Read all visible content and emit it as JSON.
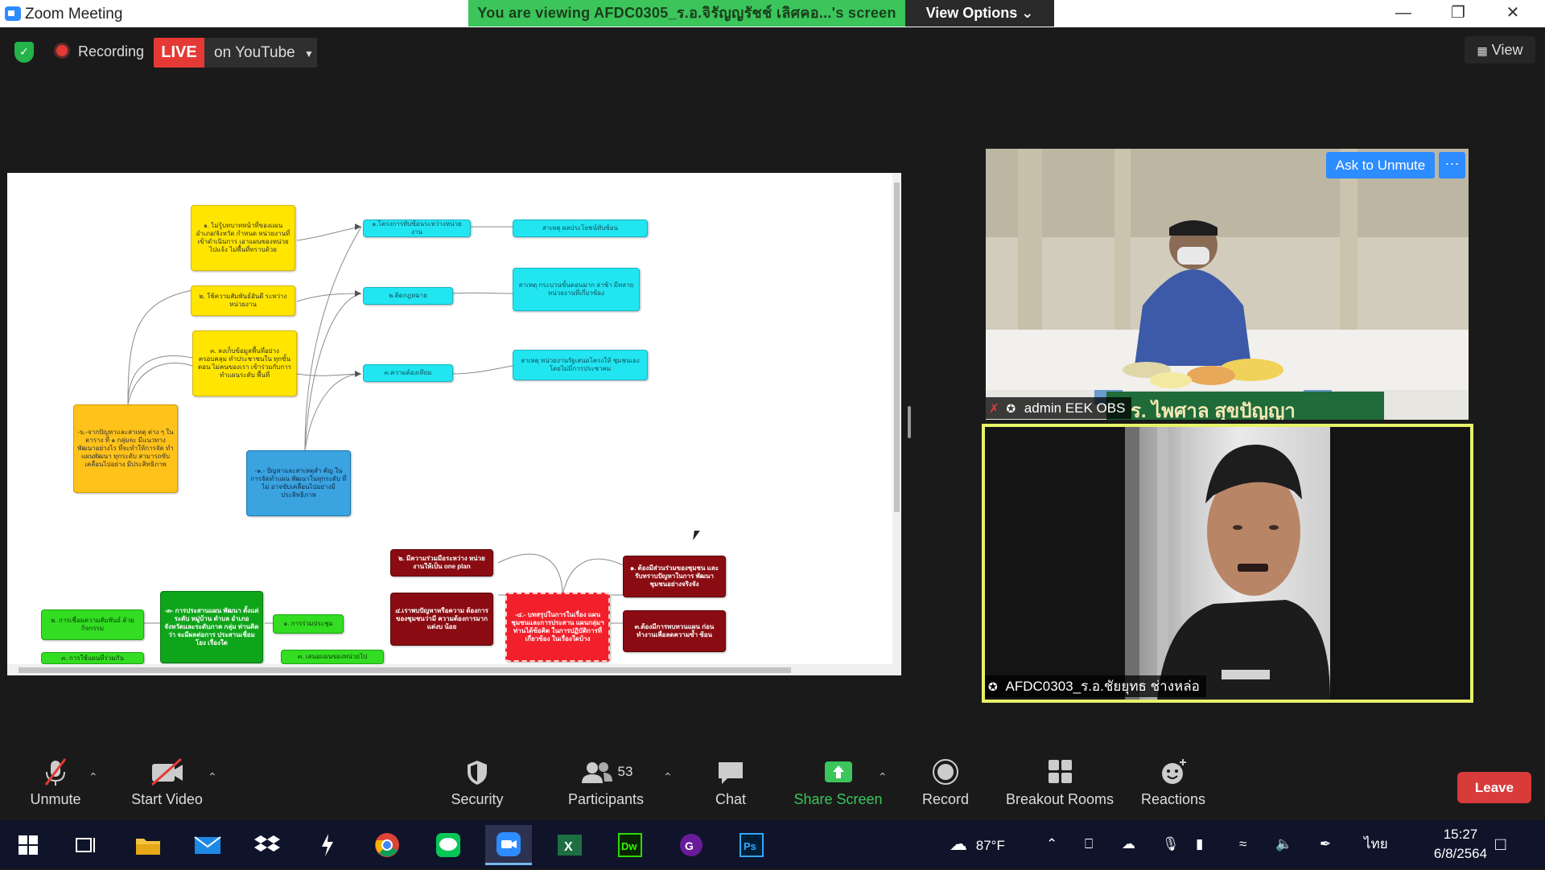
{
  "window": {
    "title": "Zoom Meeting",
    "viewing_banner": "You are viewing AFDC0305_ร.อ.จิรัญญรัชช์ เลิศคอ...'s screen",
    "view_options": "View Options ⌄"
  },
  "top_bar": {
    "recording_label": "Recording",
    "live_label": "LIVE",
    "live_target": "on YouTube",
    "view_label": "View"
  },
  "participants": {
    "top": {
      "name": "admin EEK OBS",
      "ask_unmute": "Ask to Unmute",
      "more": "···",
      "banner_text": "ร. ไพศาล สุขปัญญา"
    },
    "bottom": {
      "name": "AFDC0303_ร.อ.ชัยยุทธ ช่างหล่อ"
    }
  },
  "mindmap": {
    "nodes": [
      "๑. ไม่รู้บทบาทหน้าที่ของแผน อำเภอ/จังหวัด กำหนด หน่วยงานที่เข้าดำเนินการ เอาแผนของหน่วยไปแจ้ง ไม่พื้นที่ทราบด้วย",
      "๒. ใช้ความสัมพันธ์อันดี ระหว่างหน่วยงาน",
      "๓. ลงเก็บข้อมูลพื้นที่อย่าง ครอบคลุม ทำประชาชนใน ทุกขั้นตอน ไม่คนของเรา เข้าร่วมกับการทำแผนระดับ พื้นที่",
      "-๖.-จากปัญหาและสาเหตุ ต่าง ๆ ในตาราง ที่ ๑ กลุ่มจะ มีแนวทางพัฒนาอย่างไร ที่จะทำให้การจัด ทำแผนพัฒนา ทุกระดับ สามารถขับเคลื่อนไปอย่าง มีประสิทธิภาพ",
      "-๑.- ปัญหาและสาเหตุสำ คัญ ในการจัดทำแผน พัฒนาในทุกระดับ ที่ไม่ อาจขับเคลื่อนไปอย่างมี ประสิทธิภาพ",
      "๑.โครงการทับซ้อนระหว่างหน่วยงาน",
      "สาเหตุ ผลประโยชน์ทับซ้อน",
      "๒.ติดกฎหมาย",
      "สาเหตุ กระบวนขั้นตอนมาก ล่าช้า มีหลายหน่วยงานที่เกี่ยวข้อง",
      "๓.ความต้องเทียม",
      "สาเหตุ หน่วยงานรัฐเสนอโครงให้ ชุมชนเองโดยไม่มีการประชาคม",
      "๒. มีความร่วมมือระหว่าง หน่วยงานให้เป็น one plan",
      "๔.เราพบปัญหาหรือความ ต้องการของชุมชนว่ามี ความต้องการมาก แต่งบ น้อย",
      "-๔.- บทสรุปในการในเรื่อง แผนชุมชนและการประสาน แผนกลุ่มฯ ท่านได้ข้อคิด ในการปฏิบัติการที่ เกี่ยวข้อง ในเรื่องใดบ้าง",
      "๑. ต้องมีส่วนร่วมของชุมชน และรับทราบปัญหาในการ พัฒนาชุมชนอย่างจริงจัง",
      "๓.ต้องมีการทบทวนแผน ก่อนทำงานเพื่อลดความซ้ำ ซ้อน",
      "๒. การเชื่อมความสัมพันธ์ ด้วยกิจกรรม",
      "-๓- การประสานแผน พัฒนา ตั้งแต่ระดับ หมู่บ้าน ตำบล อำเภอ จังหวัดและระดับภาค กลุ่ม ท่านคิดว่า จะมีผลต่อการ ประสานเชื่อมโยง เรื่องใด",
      "๑. การร่วมประชุม",
      "๓. เสนอแผนของหน่วยไป",
      "๓. การใช้แผนที่ร่วมกัน"
    ]
  },
  "toolbar": {
    "unmute": "Unmute",
    "start_video": "Start Video",
    "security": "Security",
    "participants": "Participants",
    "participants_count": "53",
    "chat": "Chat",
    "share_screen": "Share Screen",
    "record": "Record",
    "breakout_rooms": "Breakout Rooms",
    "reactions": "Reactions",
    "leave": "Leave"
  },
  "taskbar": {
    "weather": "87°F",
    "language": "ไทย",
    "time": "15:27",
    "date": "6/8/2564"
  },
  "colors": {
    "zoom_blue": "#2d8cff",
    "live_red": "#e53935",
    "share_green": "#3bc55b",
    "leave_red": "#d93a3a",
    "speaker_border": "#e8f26a"
  }
}
